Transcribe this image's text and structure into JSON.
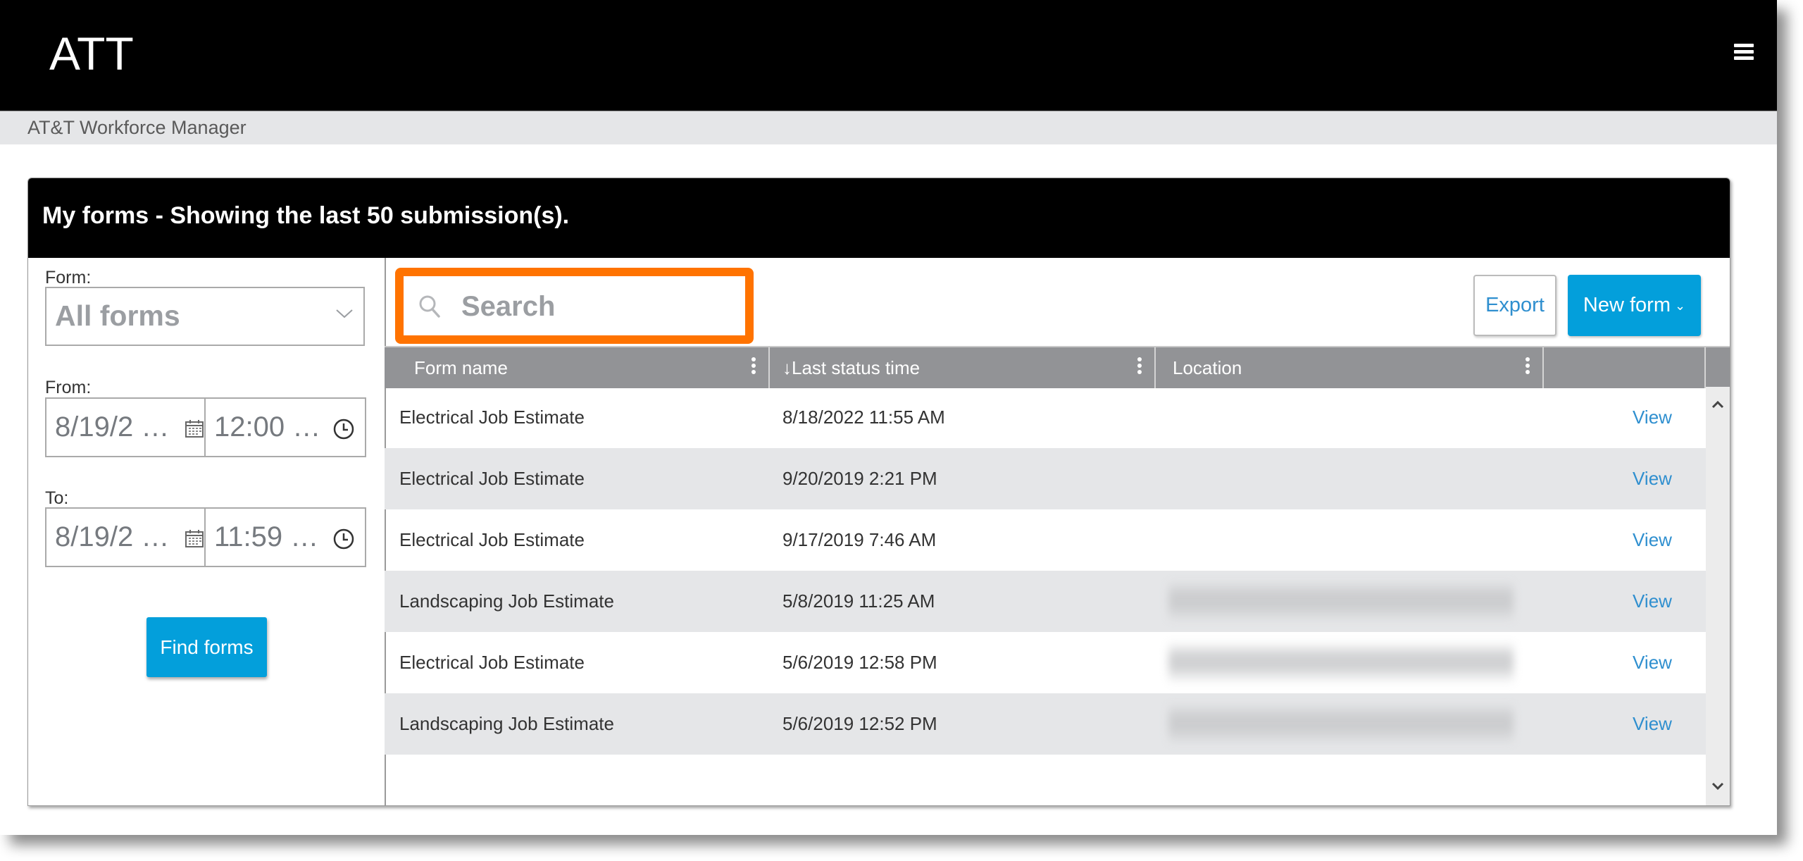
{
  "app": {
    "brand": "ATT",
    "subtitle": "AT&T Workforce Manager",
    "menu_icon": "hamburger-menu-icon"
  },
  "card": {
    "title": "My forms - Showing the last 50 submission(s)."
  },
  "filters": {
    "form_label": "Form:",
    "form_value": "All forms",
    "from_label": "From:",
    "from_date": "8/19/2 …",
    "from_time": "12:00 …",
    "to_label": "To:",
    "to_date": "8/19/2 …",
    "to_time": "11:59 …",
    "find_button": "Find forms"
  },
  "toolbar": {
    "search_placeholder": "Search",
    "export_label": "Export",
    "new_form_label": "New form",
    "highlight_color": "#ff7300",
    "accent_color": "#039fdb"
  },
  "table": {
    "columns": [
      {
        "label": "Form name",
        "sort": ""
      },
      {
        "label": "↓Last status time",
        "sort": "descending"
      },
      {
        "label": "Location",
        "sort": ""
      },
      {
        "label": "",
        "sort": ""
      }
    ],
    "rows": [
      {
        "form_name": "Electrical Job Estimate",
        "last_status_time": "8/18/2022 11:55 AM",
        "location": "",
        "location_redacted": false,
        "action": "View"
      },
      {
        "form_name": "Electrical Job Estimate",
        "last_status_time": "9/20/2019 2:21 PM",
        "location": "",
        "location_redacted": false,
        "action": "View"
      },
      {
        "form_name": "Electrical Job Estimate",
        "last_status_time": "9/17/2019 7:46 AM",
        "location": "",
        "location_redacted": false,
        "action": "View"
      },
      {
        "form_name": "Landscaping Job Estimate",
        "last_status_time": "5/8/2019 11:25 AM",
        "location": "[redacted]",
        "location_redacted": true,
        "action": "View"
      },
      {
        "form_name": "Electrical Job Estimate",
        "last_status_time": "5/6/2019 12:58 PM",
        "location": "[redacted]",
        "location_redacted": true,
        "action": "View"
      },
      {
        "form_name": "Landscaping Job Estimate",
        "last_status_time": "5/6/2019 12:52 PM",
        "location": "[redacted]",
        "location_redacted": true,
        "action": "View"
      }
    ]
  }
}
